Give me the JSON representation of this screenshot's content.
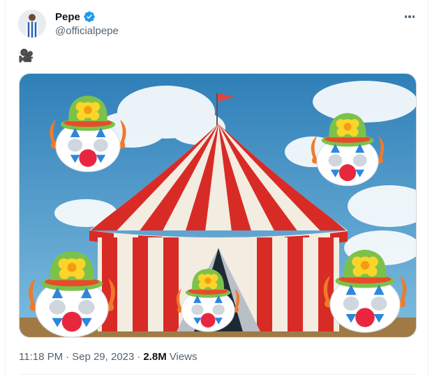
{
  "author": {
    "display_name": "Pepe",
    "handle": "@officialpepe",
    "verified": true,
    "avatar_icon": "player-avatar"
  },
  "tweet": {
    "text": "🎥",
    "media_alt": "circus-tent-with-clown-emoji-faces",
    "time": "11:18 PM",
    "separator": "·",
    "date": "Sep 29, 2023",
    "separator2": "·",
    "views_count": "2.8M",
    "views_label": "Views"
  },
  "colors": {
    "verified_blue": "#1d9bf0",
    "secondary_text": "#536471",
    "primary_text": "#0f1419",
    "tent_red": "#d92b26",
    "sky_blue": "#3a8fc8"
  },
  "icons": {
    "more": "more-horizontal-icon",
    "verified": "verified-badge-icon"
  }
}
